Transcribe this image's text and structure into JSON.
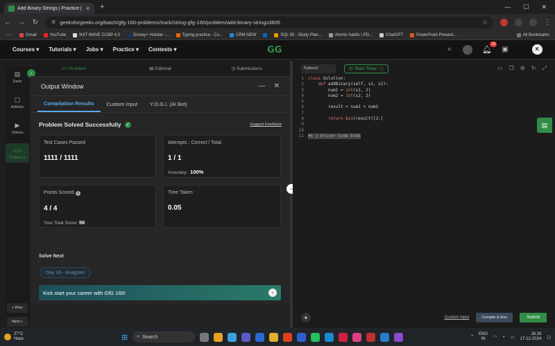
{
  "browser": {
    "tab_title": "Add Binary Strings | Practice | G",
    "url": "geeksforgeeks.org/batch/gfg-160-problems/track/string-gfg-160/problem/add-binary-strings3805",
    "bookmarks": [
      "Gmail",
      "YouTube",
      "NXT WAVE CCBP 4.0",
      "Disney+ Hotstar -...",
      "Typing practice - Co...",
      "CRM NEW",
      "",
      "SQL 50 - Study Plan...",
      "Atomic habits \\ PD...",
      "ChatGPT",
      "PowerPoint Present..."
    ],
    "all_bookmarks": "All Bookmarks"
  },
  "site": {
    "nav": [
      "Courses",
      "Tutorials",
      "Jobs",
      "Practice",
      "Contests"
    ],
    "logo": "GG",
    "notif_count": "18",
    "avatar": "K"
  },
  "rail": {
    "items": [
      {
        "icon": "▤",
        "label": "Dash"
      },
      {
        "icon": "▢",
        "label": "Articles"
      },
      {
        "icon": "▶",
        "label": "Videos"
      },
      {
        "icon": "</>",
        "label": "Problems"
      }
    ],
    "prev": "« Prev",
    "next": "Next »"
  },
  "problem_tabs": [
    "Problem",
    "Editorial",
    "Submissions"
  ],
  "output": {
    "title": "Output Window",
    "tabs": [
      "Compilation Results",
      "Custom Input",
      "Y.O.G.I. (AI Bot)"
    ],
    "status": "Problem Solved Successfully",
    "suggest": "Suggest Feedback",
    "test_cases_label": "Test Cases Passed",
    "test_cases_value": "1111 / 1111",
    "attempts_label": "Attempts : Correct / Total",
    "attempts_value": "1 / 1",
    "accuracy_label": "Accuracy :",
    "accuracy_value": "100%",
    "points_label": "Points Scored",
    "points_value": "4 / 4",
    "total_score_label": "Your Total Score:",
    "total_score_value": "56",
    "time_label": "Time Taken",
    "time_value": "0.05",
    "solve_next": "Solve Next",
    "day_pill": "Day 16 - Anagram",
    "banner": "Kick start your career with GfG 160!"
  },
  "editor": {
    "language": "Python3",
    "timer": "Start Timer",
    "custom_input": "Custom Input",
    "compile": "Compile & Run",
    "submit": "Submit",
    "lines": [
      "class Solution:",
      "    def addBinary(self, s1, s2):",
      "        num1 = int(s1, 2)",
      "        num2 = int(s2, 2)",
      "",
      "        result = num1 + num2",
      "",
      "        return bin(result)[2:]",
      "",
      "",
      "#{ } Driver Code Ends"
    ]
  },
  "taskbar": {
    "temp": "27°C",
    "weather": "Haze",
    "search": "Search",
    "lang1": "ENG",
    "lang2": "IN",
    "time": "16:26",
    "date": "17-12-2024"
  },
  "colors": {
    "accent": "#2f8d46",
    "tab_active": "#5aaaf0"
  }
}
